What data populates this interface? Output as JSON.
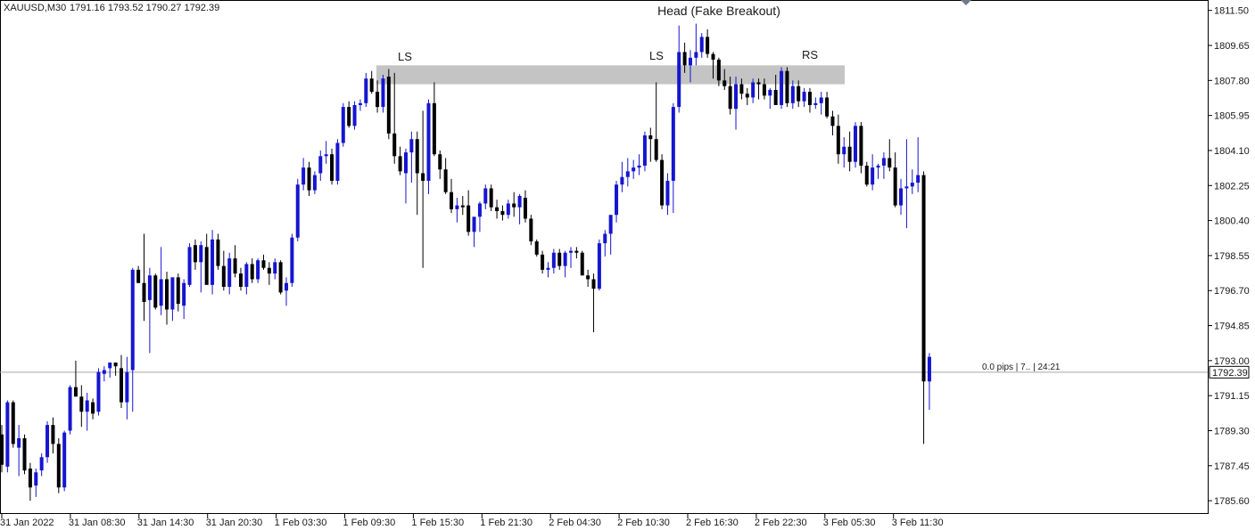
{
  "header": {
    "symbol": "XAUUSD,M30",
    "ohlc": "1791.16 1793.52 1790.27 1792.39"
  },
  "annotations": {
    "head": "Head (Fake Breakout)",
    "ls1": "LS",
    "ls2": "LS",
    "rs": "RS"
  },
  "current_price": {
    "label": "1792.39",
    "info": "0.0 pips | 7.. | 24:21"
  },
  "colors": {
    "bull": "#1515d0",
    "bear": "#000000",
    "zone": "#c4c4c4",
    "grid": "#a8a8a8",
    "axis": "#000000"
  },
  "chart_data": {
    "type": "candlestick",
    "y_ticks": [
      "1811.50",
      "1809.65",
      "1807.80",
      "1805.95",
      "1804.10",
      "1802.25",
      "1800.40",
      "1798.55",
      "1796.70",
      "1794.85",
      "1793.00",
      "1791.15",
      "1789.30",
      "1787.45",
      "1785.60"
    ],
    "x_ticks": [
      "31 Jan 2022",
      "31 Jan 08:30",
      "31 Jan 14:30",
      "31 Jan 20:30",
      "1 Feb 03:30",
      "1 Feb 09:30",
      "1 Feb 15:30",
      "1 Feb 21:30",
      "2 Feb 04:30",
      "2 Feb 10:30",
      "2 Feb 16:30",
      "2 Feb 22:30",
      "3 Feb 05:30",
      "3 Feb 11:30"
    ],
    "ylim": [
      1784.9,
      1812.05
    ],
    "resistance_zone": {
      "low": 1807.6,
      "high": 1808.6
    },
    "candles": [
      [
        1789.1,
        1789.6,
        1787.1,
        1787.5
      ],
      [
        1787.4,
        1790.9,
        1787.1,
        1790.8
      ],
      [
        1790.8,
        1790.9,
        1788.4,
        1788.6
      ],
      [
        1788.4,
        1789.6,
        1786.9,
        1788.9
      ],
      [
        1788.9,
        1789.1,
        1787.0,
        1787.2
      ],
      [
        1787.3,
        1787.6,
        1785.6,
        1786.3
      ],
      [
        1786.4,
        1787.3,
        1785.8,
        1787.1
      ],
      [
        1787.2,
        1788.1,
        1786.9,
        1787.9
      ],
      [
        1787.9,
        1789.8,
        1787.6,
        1789.6
      ],
      [
        1789.6,
        1790.0,
        1788.1,
        1788.6
      ],
      [
        1788.6,
        1788.9,
        1786.0,
        1786.3
      ],
      [
        1786.3,
        1789.3,
        1786.1,
        1789.2
      ],
      [
        1789.3,
        1791.7,
        1789.1,
        1791.6
      ],
      [
        1791.6,
        1793.0,
        1791.1,
        1791.1
      ],
      [
        1791.1,
        1791.7,
        1789.5,
        1790.3
      ],
      [
        1790.3,
        1791.3,
        1789.3,
        1790.9
      ],
      [
        1790.8,
        1791.0,
        1789.9,
        1790.2
      ],
      [
        1790.3,
        1792.6,
        1790.1,
        1792.4
      ],
      [
        1792.3,
        1792.7,
        1791.9,
        1792.5
      ],
      [
        1792.6,
        1792.9,
        1792.1,
        1792.9
      ],
      [
        1792.9,
        1792.9,
        1792.2,
        1792.7
      ],
      [
        1792.6,
        1793.3,
        1790.5,
        1790.8
      ],
      [
        1790.8,
        1793.2,
        1789.9,
        1792.4
      ],
      [
        1792.5,
        1797.9,
        1790.3,
        1797.8
      ],
      [
        1797.8,
        1798.0,
        1797.1,
        1797.1
      ],
      [
        1797.1,
        1799.7,
        1795.1,
        1796.1
      ],
      [
        1796.2,
        1797.9,
        1793.4,
        1797.5
      ],
      [
        1797.5,
        1797.6,
        1795.7,
        1795.8
      ],
      [
        1795.9,
        1799.0,
        1795.4,
        1797.3
      ],
      [
        1797.3,
        1797.7,
        1794.9,
        1795.7
      ],
      [
        1795.7,
        1797.4,
        1795.1,
        1797.4
      ],
      [
        1797.4,
        1797.6,
        1795.6,
        1796.0
      ],
      [
        1795.9,
        1797.3,
        1795.2,
        1797.1
      ],
      [
        1797.0,
        1799.2,
        1796.9,
        1799.0
      ],
      [
        1799.1,
        1799.4,
        1797.8,
        1798.2
      ],
      [
        1798.2,
        1799.3,
        1796.6,
        1799.1
      ],
      [
        1799.0,
        1799.7,
        1797.9,
        1797.0
      ],
      [
        1797.0,
        1799.9,
        1796.5,
        1799.4
      ],
      [
        1799.4,
        1799.7,
        1797.8,
        1798.0
      ],
      [
        1798.0,
        1798.8,
        1796.7,
        1796.9
      ],
      [
        1796.9,
        1798.7,
        1796.5,
        1798.4
      ],
      [
        1798.4,
        1799.1,
        1797.4,
        1797.6
      ],
      [
        1797.6,
        1797.9,
        1796.7,
        1796.9
      ],
      [
        1796.9,
        1798.2,
        1796.5,
        1798.1
      ],
      [
        1798.1,
        1798.4,
        1797.1,
        1797.3
      ],
      [
        1797.3,
        1798.4,
        1797.1,
        1798.3
      ],
      [
        1798.3,
        1798.6,
        1797.8,
        1797.9
      ],
      [
        1797.9,
        1798.2,
        1797.0,
        1797.6
      ],
      [
        1797.6,
        1798.4,
        1797.3,
        1798.2
      ],
      [
        1798.2,
        1798.3,
        1796.5,
        1796.6
      ],
      [
        1796.7,
        1797.4,
        1795.9,
        1797.1
      ],
      [
        1797.1,
        1799.7,
        1796.9,
        1799.5
      ],
      [
        1799.5,
        1802.6,
        1799.3,
        1802.3
      ],
      [
        1802.3,
        1803.7,
        1802.0,
        1803.2
      ],
      [
        1803.2,
        1803.5,
        1801.7,
        1802.0
      ],
      [
        1802.0,
        1803.0,
        1801.8,
        1802.8
      ],
      [
        1802.9,
        1804.1,
        1802.5,
        1803.8
      ],
      [
        1803.8,
        1804.6,
        1803.4,
        1803.9
      ],
      [
        1803.9,
        1804.2,
        1802.3,
        1802.5
      ],
      [
        1802.5,
        1804.7,
        1802.3,
        1804.5
      ],
      [
        1804.5,
        1806.6,
        1804.3,
        1806.4
      ],
      [
        1806.4,
        1806.7,
        1805.3,
        1805.4
      ],
      [
        1805.4,
        1806.7,
        1805.2,
        1806.5
      ],
      [
        1806.5,
        1806.8,
        1806.2,
        1806.6
      ],
      [
        1806.6,
        1808.2,
        1806.4,
        1807.9
      ],
      [
        1807.9,
        1808.3,
        1807.1,
        1807.2
      ],
      [
        1807.2,
        1807.8,
        1806.1,
        1806.4
      ],
      [
        1806.4,
        1808.1,
        1806.1,
        1807.9
      ],
      [
        1808.0,
        1808.4,
        1804.7,
        1805.0
      ],
      [
        1805.0,
        1808.2,
        1803.4,
        1803.8
      ],
      [
        1803.8,
        1804.3,
        1802.8,
        1803.0
      ],
      [
        1802.9,
        1804.2,
        1801.3,
        1804.0
      ],
      [
        1804.0,
        1805.1,
        1802.4,
        1804.7
      ],
      [
        1804.7,
        1805.1,
        1800.7,
        1802.9
      ],
      [
        1802.9,
        1806.2,
        1797.9,
        1802.5
      ],
      [
        1802.5,
        1806.8,
        1801.8,
        1806.6
      ],
      [
        1806.6,
        1807.7,
        1803.8,
        1803.9
      ],
      [
        1803.9,
        1804.1,
        1802.6,
        1803.1
      ],
      [
        1803.1,
        1803.7,
        1801.8,
        1801.9
      ],
      [
        1801.9,
        1802.6,
        1800.8,
        1801.0
      ],
      [
        1801.0,
        1801.6,
        1800.3,
        1801.2
      ],
      [
        1801.2,
        1801.7,
        1800.7,
        1801.1
      ],
      [
        1801.2,
        1802.0,
        1799.6,
        1799.8
      ],
      [
        1799.8,
        1800.3,
        1799.0,
        1800.6
      ],
      [
        1800.6,
        1801.4,
        1799.8,
        1801.3
      ],
      [
        1801.3,
        1802.3,
        1801.0,
        1802.1
      ],
      [
        1802.1,
        1802.3,
        1800.9,
        1801.1
      ],
      [
        1801.1,
        1801.5,
        1800.5,
        1800.9
      ],
      [
        1800.9,
        1801.2,
        1800.4,
        1800.7
      ],
      [
        1800.7,
        1801.5,
        1800.5,
        1801.3
      ],
      [
        1801.3,
        1801.9,
        1800.6,
        1801.1
      ],
      [
        1801.1,
        1801.8,
        1800.2,
        1801.7
      ],
      [
        1801.6,
        1802.0,
        1800.3,
        1800.5
      ],
      [
        1800.5,
        1800.7,
        1799.1,
        1799.3
      ],
      [
        1799.3,
        1799.4,
        1798.5,
        1798.6
      ],
      [
        1798.6,
        1798.8,
        1797.6,
        1797.8
      ],
      [
        1797.8,
        1798.2,
        1797.4,
        1797.9
      ],
      [
        1797.9,
        1798.9,
        1797.6,
        1798.7
      ],
      [
        1798.7,
        1798.9,
        1797.8,
        1798.0
      ],
      [
        1798.0,
        1798.8,
        1797.4,
        1798.7
      ],
      [
        1798.7,
        1799.0,
        1797.9,
        1798.8
      ],
      [
        1798.8,
        1799.0,
        1798.4,
        1798.7
      ],
      [
        1798.7,
        1798.8,
        1797.5,
        1797.5
      ],
      [
        1797.5,
        1797.8,
        1796.9,
        1797.3
      ],
      [
        1797.3,
        1797.6,
        1794.5,
        1796.8
      ],
      [
        1796.8,
        1799.4,
        1796.7,
        1799.2
      ],
      [
        1799.2,
        1799.9,
        1798.5,
        1799.7
      ],
      [
        1799.7,
        1799.8,
        1798.6,
        1800.7
      ],
      [
        1800.7,
        1802.5,
        1800.3,
        1802.3
      ],
      [
        1802.3,
        1803.5,
        1801.9,
        1802.7
      ],
      [
        1802.7,
        1803.7,
        1802.2,
        1803.0
      ],
      [
        1803.0,
        1803.6,
        1802.6,
        1803.2
      ],
      [
        1803.2,
        1803.9,
        1802.8,
        1803.3
      ],
      [
        1803.3,
        1805.1,
        1803.0,
        1804.9
      ],
      [
        1804.9,
        1805.3,
        1803.5,
        1804.7
      ],
      [
        1804.7,
        1807.7,
        1803.5,
        1803.6
      ],
      [
        1803.6,
        1803.9,
        1801.0,
        1801.2
      ],
      [
        1801.2,
        1802.9,
        1800.7,
        1802.5
      ],
      [
        1802.5,
        1806.6,
        1800.8,
        1806.4
      ],
      [
        1806.4,
        1810.7,
        1806.1,
        1809.3
      ],
      [
        1809.3,
        1809.8,
        1808.2,
        1808.6
      ],
      [
        1808.6,
        1809.4,
        1807.7,
        1809.0
      ],
      [
        1809.0,
        1810.8,
        1808.6,
        1809.3
      ],
      [
        1809.3,
        1810.3,
        1809.0,
        1810.1
      ],
      [
        1810.1,
        1810.5,
        1809.0,
        1809.2
      ],
      [
        1809.2,
        1809.3,
        1807.9,
        1808.9
      ],
      [
        1808.9,
        1809.0,
        1807.5,
        1807.8
      ],
      [
        1807.8,
        1808.4,
        1807.3,
        1807.5
      ],
      [
        1807.5,
        1808.0,
        1806.0,
        1806.3
      ],
      [
        1806.3,
        1808.0,
        1805.2,
        1807.6
      ],
      [
        1807.6,
        1807.9,
        1806.8,
        1807.1
      ],
      [
        1807.1,
        1807.4,
        1806.5,
        1806.9
      ],
      [
        1806.9,
        1807.9,
        1806.6,
        1807.7
      ],
      [
        1807.7,
        1807.9,
        1806.8,
        1807.6
      ],
      [
        1807.6,
        1807.9,
        1806.8,
        1807.0
      ],
      [
        1807.0,
        1807.4,
        1806.3,
        1807.3
      ],
      [
        1807.3,
        1808.1,
        1806.7,
        1806.5
      ],
      [
        1806.5,
        1808.5,
        1806.3,
        1808.3
      ],
      [
        1808.3,
        1808.5,
        1806.4,
        1806.6
      ],
      [
        1806.6,
        1807.8,
        1806.3,
        1807.5
      ],
      [
        1807.5,
        1807.8,
        1806.4,
        1806.7
      ],
      [
        1806.7,
        1807.4,
        1806.4,
        1807.2
      ],
      [
        1807.2,
        1807.4,
        1806.1,
        1806.5
      ],
      [
        1806.5,
        1806.9,
        1806.3,
        1806.6
      ],
      [
        1806.6,
        1807.2,
        1806.0,
        1806.9
      ],
      [
        1806.9,
        1807.2,
        1805.8,
        1805.9
      ],
      [
        1805.9,
        1806.2,
        1804.9,
        1805.4
      ],
      [
        1805.4,
        1806.0,
        1803.4,
        1803.9
      ],
      [
        1803.9,
        1804.8,
        1803.2,
        1804.3
      ],
      [
        1804.3,
        1805.1,
        1803.0,
        1803.5
      ],
      [
        1803.5,
        1805.6,
        1803.2,
        1805.4
      ],
      [
        1805.4,
        1805.6,
        1802.9,
        1803.3
      ],
      [
        1803.3,
        1803.5,
        1802.2,
        1802.3
      ],
      [
        1802.3,
        1803.9,
        1802.0,
        1803.2
      ],
      [
        1803.2,
        1803.4,
        1802.6,
        1803.3
      ],
      [
        1803.3,
        1804.0,
        1802.6,
        1803.7
      ],
      [
        1803.7,
        1804.7,
        1803.0,
        1803.2
      ],
      [
        1803.2,
        1804.0,
        1801.1,
        1801.2
      ],
      [
        1801.2,
        1802.6,
        1800.7,
        1802.1
      ],
      [
        1802.1,
        1804.7,
        1800.0,
        1802.2
      ],
      [
        1802.2,
        1803.1,
        1801.8,
        1802.4
      ],
      [
        1802.4,
        1804.8,
        1801.9,
        1802.8
      ],
      [
        1802.8,
        1803.0,
        1788.6,
        1791.9
      ],
      [
        1791.9,
        1793.4,
        1790.4,
        1793.2
      ]
    ]
  }
}
